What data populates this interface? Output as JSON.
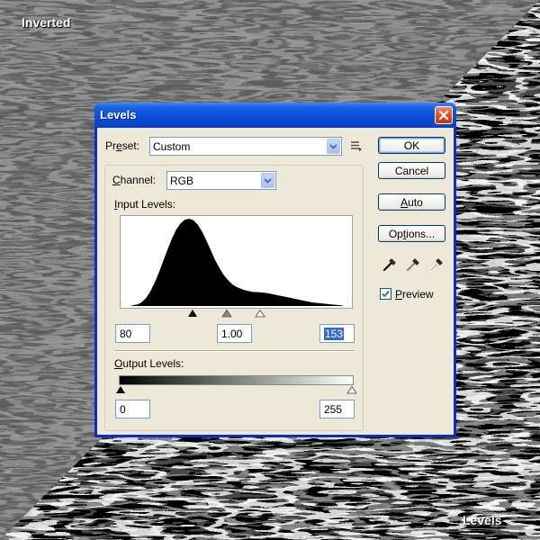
{
  "overlay": {
    "top_left_label": "Inverted",
    "bottom_right_label": "Levels"
  },
  "dialog": {
    "title": "Levels",
    "preset": {
      "label_prefix": "Pr",
      "label_u": "e",
      "label_suffix": "set:",
      "value": "Custom"
    },
    "channel": {
      "label_u": "C",
      "label_suffix": "hannel:",
      "value": "RGB"
    },
    "input_levels": {
      "label_u": "I",
      "label_suffix": "nput Levels:",
      "black": "80",
      "gamma": "1.00",
      "white": "153"
    },
    "output_levels": {
      "label_u": "O",
      "label_suffix": "utput Levels:",
      "black": "0",
      "white": "255"
    },
    "buttons": {
      "ok": "OK",
      "cancel": "Cancel",
      "auto_u": "A",
      "auto_suffix": "uto",
      "options_prefix": "Op",
      "options_u": "t",
      "options_suffix": "ions..."
    },
    "preview": {
      "label_u": "P",
      "label_suffix": "review",
      "checked": true
    }
  },
  "histogram_profile": [
    0.0,
    0.01,
    0.02,
    0.05,
    0.1,
    0.18,
    0.28,
    0.4,
    0.53,
    0.66,
    0.78,
    0.88,
    0.95,
    0.99,
    1.0,
    0.98,
    0.93,
    0.85,
    0.75,
    0.64,
    0.53,
    0.44,
    0.36,
    0.3,
    0.25,
    0.22,
    0.2,
    0.18,
    0.17,
    0.16,
    0.16,
    0.155,
    0.15,
    0.14,
    0.13,
    0.12,
    0.11,
    0.1,
    0.09,
    0.08,
    0.07,
    0.06,
    0.05,
    0.04,
    0.035,
    0.03,
    0.025,
    0.02,
    0.015,
    0.01,
    0.005
  ],
  "colors": {
    "title_blue": "#0a4ed8",
    "dialog_face": "#ece9d8",
    "accent": "#316ac5"
  }
}
